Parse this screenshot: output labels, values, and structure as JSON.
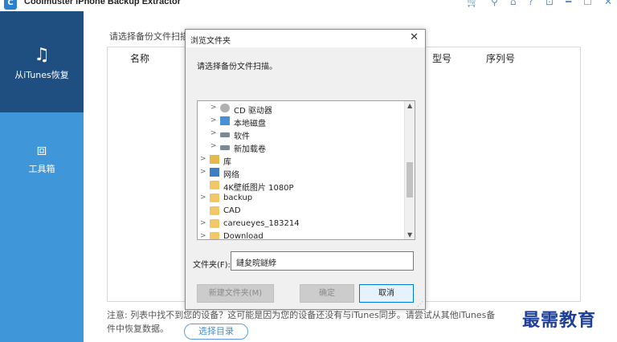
{
  "app": {
    "title": "Coolmuster iPhone Backup Extractor",
    "logo": "C"
  },
  "titlebar_icons": [
    "cart-icon",
    "key-icon",
    "home-icon",
    "help-icon",
    "feedback-icon",
    "minimize-icon",
    "maximize-icon",
    "close-icon"
  ],
  "titlebar_glyphs": [
    "🛒",
    "⚲",
    "⌂",
    "?",
    "⊡",
    "━",
    "☐",
    "✕"
  ],
  "sidebar": {
    "items": [
      {
        "label": "从iTunes恢复",
        "icon": "music-sync-icon",
        "glyph": "♫"
      },
      {
        "label": "工具箱",
        "icon": "toolbox-icon",
        "glyph": "⧈"
      }
    ],
    "active_color": "#1f4e80",
    "color": "#3f97da"
  },
  "main": {
    "hint": "请选择备份文件扫描：",
    "columns": {
      "name": "名称",
      "model": "型号",
      "serial": "序列号"
    },
    "note_line1": "注意: 列表中找不到您的设备？这可能是因为您的设备还没有与iTunes同步。请尝试从其他iTunes备",
    "note_line2": "件中恢复数据。",
    "select_dir_button": "选择目录"
  },
  "dialog": {
    "title": "浏览文件夹",
    "close": "✕",
    "instruction": "请选择备份文件扫描。",
    "tree": [
      {
        "label": "CD 驱动器",
        "icon": "cd-drive-icon",
        "indent": 2,
        "expand": true
      },
      {
        "label": "本地磁盘",
        "icon": "local-disk-icon",
        "indent": 2,
        "expand": true
      },
      {
        "label": "软件",
        "icon": "drive-icon",
        "indent": 2,
        "expand": true
      },
      {
        "label": "新加载卷",
        "icon": "drive-icon",
        "indent": 2,
        "expand": true
      },
      {
        "label": "库",
        "icon": "library-icon",
        "indent": 1,
        "expand": true
      },
      {
        "label": "网络",
        "icon": "network-icon",
        "indent": 1,
        "expand": true
      },
      {
        "label": "4K壁纸图片 1080P",
        "icon": "folder-icon",
        "indent": 1,
        "expand": false
      },
      {
        "label": "backup",
        "icon": "folder-icon",
        "indent": 1,
        "expand": true
      },
      {
        "label": "CAD",
        "icon": "folder-icon",
        "indent": 1,
        "expand": false
      },
      {
        "label": "careueyes_183214",
        "icon": "folder-icon",
        "indent": 1,
        "expand": true
      },
      {
        "label": "Download",
        "icon": "folder-icon",
        "indent": 1,
        "expand": true
      }
    ],
    "folder_label": "文件夹(F):",
    "folder_value": "鏈夋晥鐩綍",
    "new_folder_button": "新建文件夹(M)",
    "ok_button": "确定",
    "cancel_button": "取消"
  },
  "watermark": "最需教育"
}
